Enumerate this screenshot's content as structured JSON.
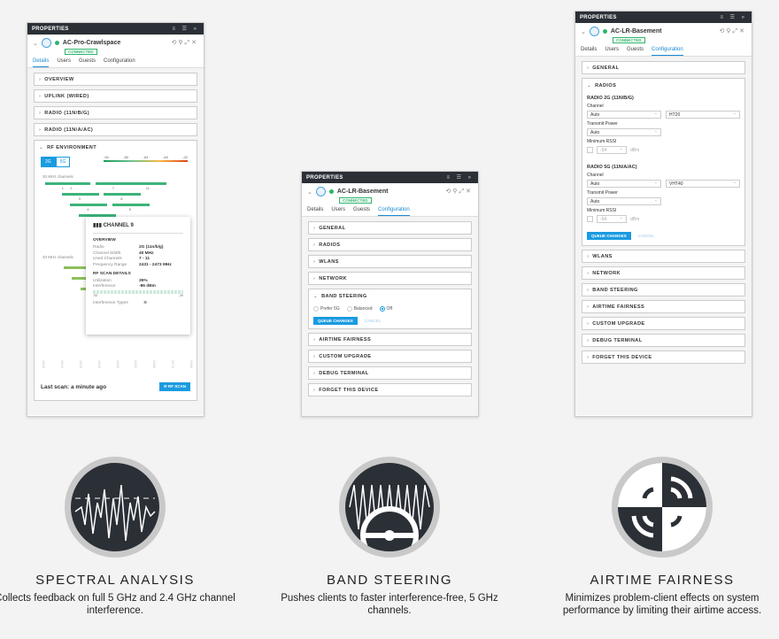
{
  "panel_title": "PROPERTIES",
  "connected": "CONNECTED",
  "tabs": [
    "Details",
    "Users",
    "Guests",
    "Configuration"
  ],
  "panel1": {
    "device": "AC-Pro-Crawlspace",
    "active_tab": 0,
    "sections": [
      "OVERVIEW",
      "UPLINK (WIRED)",
      "RADIO (11N/B/G)",
      "RADIO (11N/A/AC)"
    ],
    "rf": {
      "title": "RF ENVIRONMENT",
      "bands": [
        "2G",
        "5G"
      ],
      "active_band": "2G",
      "scale": [
        "-94",
        "-80",
        "-64",
        "-48",
        "-32"
      ],
      "label_20": "20 MHz channels",
      "label_40": "40 MHz channels",
      "channels_20": [
        "1",
        "6",
        "11",
        "2",
        "7",
        "3",
        "8",
        "4",
        "9",
        "5"
      ],
      "channels_40": [
        "3",
        "4",
        "5",
        "6",
        "7",
        "8",
        "9"
      ],
      "freq_ticks": [
        "2400",
        "2410",
        "2420",
        "2430",
        "2440",
        "2450",
        "2460",
        "2470",
        "2480"
      ],
      "last_scan": "Last scan: a minute ago",
      "scan_button": "RF SCAN",
      "tooltip": {
        "title": "CHANNEL 9",
        "overview": "OVERVIEW",
        "rows": [
          [
            "Radio",
            "2G (11n/b/g)"
          ],
          [
            "Channel Width",
            "40 MHz"
          ],
          [
            "Used Channels",
            "7 - 11"
          ],
          [
            "Frequency Range",
            "2431 - 2473 MHz"
          ]
        ],
        "scan_title": "RF SCAN DETAILS",
        "scan_rows": [
          [
            "Utilization",
            "35%"
          ],
          [
            "Interference",
            "-86 dBm"
          ]
        ],
        "range_min": "-93",
        "range_max": "-29",
        "interference_types": "Interference Types"
      }
    }
  },
  "panel2": {
    "device": "AC-LR-Basement",
    "active_tab": 3,
    "sections_before": [
      "GENERAL",
      "RADIOS",
      "WLANS",
      "NETWORK"
    ],
    "band_steering": {
      "title": "BAND STEERING",
      "options": [
        "Prefer 5G",
        "Balanced",
        "Off"
      ],
      "selected": "Off",
      "queue": "QUEUE CHANGES",
      "cancel": "CANCEL"
    },
    "sections_after": [
      "AIRTIME FAIRNESS",
      "CUSTOM UPGRADE",
      "DEBUG TERMINAL",
      "FORGET THIS DEVICE"
    ]
  },
  "panel3": {
    "device": "AC-LR-Basement",
    "active_tab": 3,
    "general": "GENERAL",
    "radios": {
      "title": "RADIOS",
      "blocks": [
        {
          "title": "RADIO 2G (11N/B/G)",
          "channel_label": "Channel",
          "channel": "Auto",
          "width": "HT20",
          "power_label": "Transmit Power",
          "power": "Auto",
          "rssi_label": "Minimum RSSI",
          "rssi": "-94",
          "unit": "dBm"
        },
        {
          "title": "RADIO 5G (11N/A/AC)",
          "channel_label": "Channel",
          "channel": "Auto",
          "width": "VHT40",
          "power_label": "Transmit Power",
          "power": "Auto",
          "rssi_label": "Minimum RSSI",
          "rssi": "-94",
          "unit": "dBm"
        }
      ],
      "queue": "QUEUE CHANGES",
      "cancel": "CANCEL"
    },
    "sections_after": [
      "WLANS",
      "NETWORK",
      "BAND STEERING",
      "AIRTIME FAIRNESS",
      "CUSTOM UPGRADE",
      "DEBUG TERMINAL",
      "FORGET THIS DEVICE"
    ]
  },
  "features": [
    {
      "title": "SPECTRAL ANALYSIS",
      "desc": "Collects feedback on full 5 GHz and 2.4 GHz channel interference.",
      "icon": "spectrum-waveform-icon"
    },
    {
      "title": "BAND STEERING",
      "desc": "Pushes clients to faster interference-free, 5 GHz channels.",
      "icon": "steering-wheel-icon"
    },
    {
      "title": "AIRTIME FAIRNESS",
      "desc": "Minimizes problem-client effects on system performance by limiting their airtime access.",
      "icon": "airtime-quadrant-icon"
    }
  ]
}
